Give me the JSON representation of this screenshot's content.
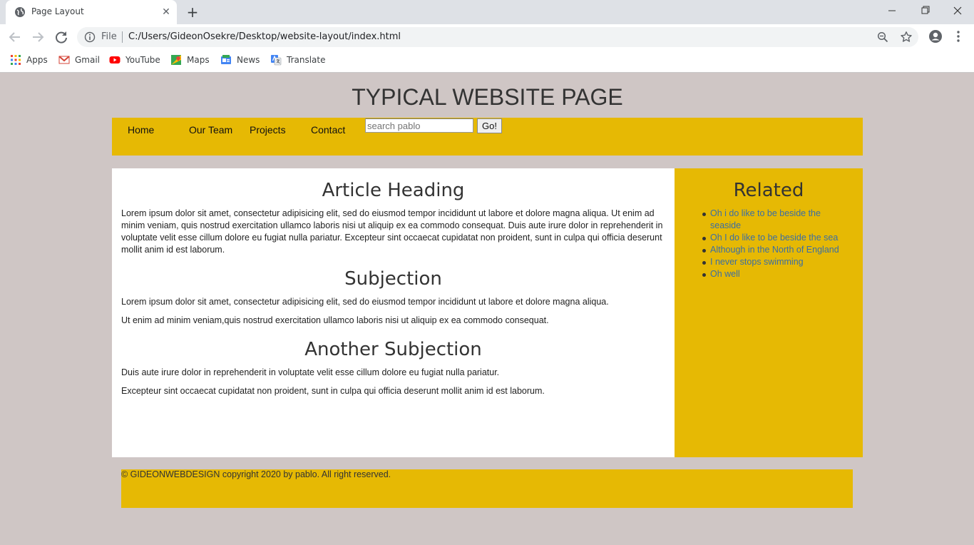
{
  "browser": {
    "tab_title": "Page Layout",
    "tab_close": "✕",
    "new_tab": "+",
    "file_label": "File",
    "url": "C:/Users/GideonOsekre/Desktop/website-layout/index.html",
    "bookmarks": [
      {
        "label": "Apps",
        "icon": "apps-grid-icon"
      },
      {
        "label": "Gmail",
        "icon": "gmail-icon"
      },
      {
        "label": "YouTube",
        "icon": "youtube-icon"
      },
      {
        "label": "Maps",
        "icon": "maps-icon"
      },
      {
        "label": "News",
        "icon": "news-icon"
      },
      {
        "label": "Translate",
        "icon": "translate-icon"
      }
    ]
  },
  "page": {
    "site_title": "TYPICAL WEBSITE PAGE",
    "nav": {
      "items": [
        "Home",
        "Our Team",
        "Projects",
        "Contact"
      ],
      "search_placeholder": "search pablo",
      "search_button": "Go!"
    },
    "article": {
      "heading": "Article Heading",
      "intro": "Lorem ipsum dolor sit amet, consectetur adipisicing elit, sed do eiusmod tempor incididunt ut labore et dolore magna aliqua. Ut enim ad minim veniam, quis nostrud exercitation ullamco laboris nisi ut aliquip ex ea commodo consequat. Duis aute irure dolor in reprehenderit in voluptate velit esse cillum dolore eu fugiat nulla pariatur. Excepteur sint occaecat cupidatat non proident, sunt in culpa qui officia deserunt mollit anim id est laborum.",
      "sections": [
        {
          "heading": "Subjection",
          "paragraphs": [
            "Lorem ipsum dolor sit amet, consectetur adipisicing elit, sed do eiusmod tempor incididunt ut labore et dolore magna aliqua.",
            "Ut enim ad minim veniam,quis nostrud exercitation ullamco laboris nisi ut aliquip ex ea commodo consequat."
          ]
        },
        {
          "heading": "Another Subjection",
          "paragraphs": [
            "Duis aute irure dolor in reprehenderit in voluptate velit esse cillum dolore eu fugiat nulla pariatur.",
            "Excepteur sint occaecat cupidatat non proident, sunt in culpa qui officia deserunt mollit anim id est laborum."
          ]
        }
      ]
    },
    "aside": {
      "heading": "Related",
      "links": [
        "Oh i do like to be beside the seaside",
        "Oh I do like to be beside the sea",
        "Although in the North of England",
        "I never stops swimming",
        "Oh well"
      ]
    },
    "footer": "© GIDEONWEBDESIGN copyright 2020 by pablo. All right reserved."
  },
  "colors": {
    "page_background": "#cfc6c5",
    "accent_yellow": "#e6b904",
    "link_blue": "#3a6ea5"
  }
}
